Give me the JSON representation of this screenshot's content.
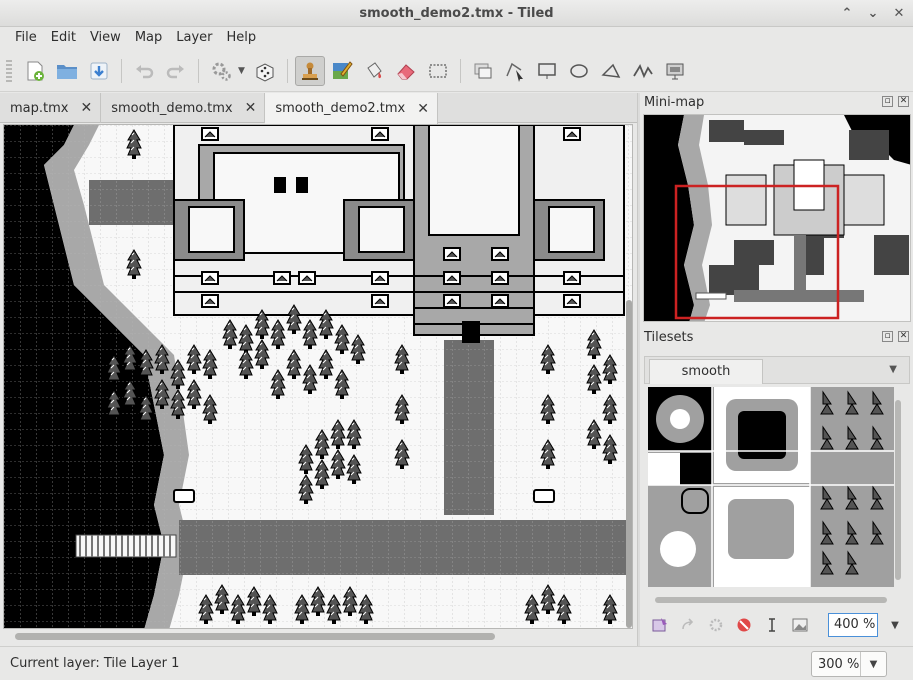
{
  "window": {
    "title": "smooth_demo2.tmx - Tiled",
    "controls": [
      "⌃",
      "⌄",
      "✕"
    ]
  },
  "menubar": {
    "items": [
      "File",
      "Edit",
      "View",
      "Map",
      "Layer",
      "Help"
    ]
  },
  "toolbar": {
    "icons": [
      "new-map-icon",
      "open-icon",
      "save-icon",
      "undo-icon",
      "redo-icon",
      "command-icon",
      "random-mode-icon",
      "stamp-brush-icon",
      "terrain-brush-icon",
      "bucket-fill-icon",
      "eraser-icon",
      "rectangular-select-icon",
      "select-objects-icon",
      "edit-polygons-icon",
      "insert-rectangle-icon",
      "insert-ellipse-icon",
      "insert-polygon-icon",
      "insert-polyline-icon",
      "insert-tile-icon"
    ],
    "active": "stamp-brush-icon"
  },
  "document_tabs": [
    {
      "label": "map.tmx",
      "active": false
    },
    {
      "label": "smooth_demo.tmx",
      "active": false
    },
    {
      "label": "smooth_demo2.tmx",
      "active": true
    }
  ],
  "minimap": {
    "title": "Mini-map"
  },
  "tilesets": {
    "title": "Tilesets",
    "tab": "smooth",
    "zoom": "400 %"
  },
  "status": {
    "text": "Current layer: Tile Layer 1",
    "zoom": "300 %"
  },
  "colors": {
    "black": "#000000",
    "dark": "#565656",
    "light": "#a8a8a8",
    "white": "#f8f8f8",
    "selection": "#cc2222"
  }
}
